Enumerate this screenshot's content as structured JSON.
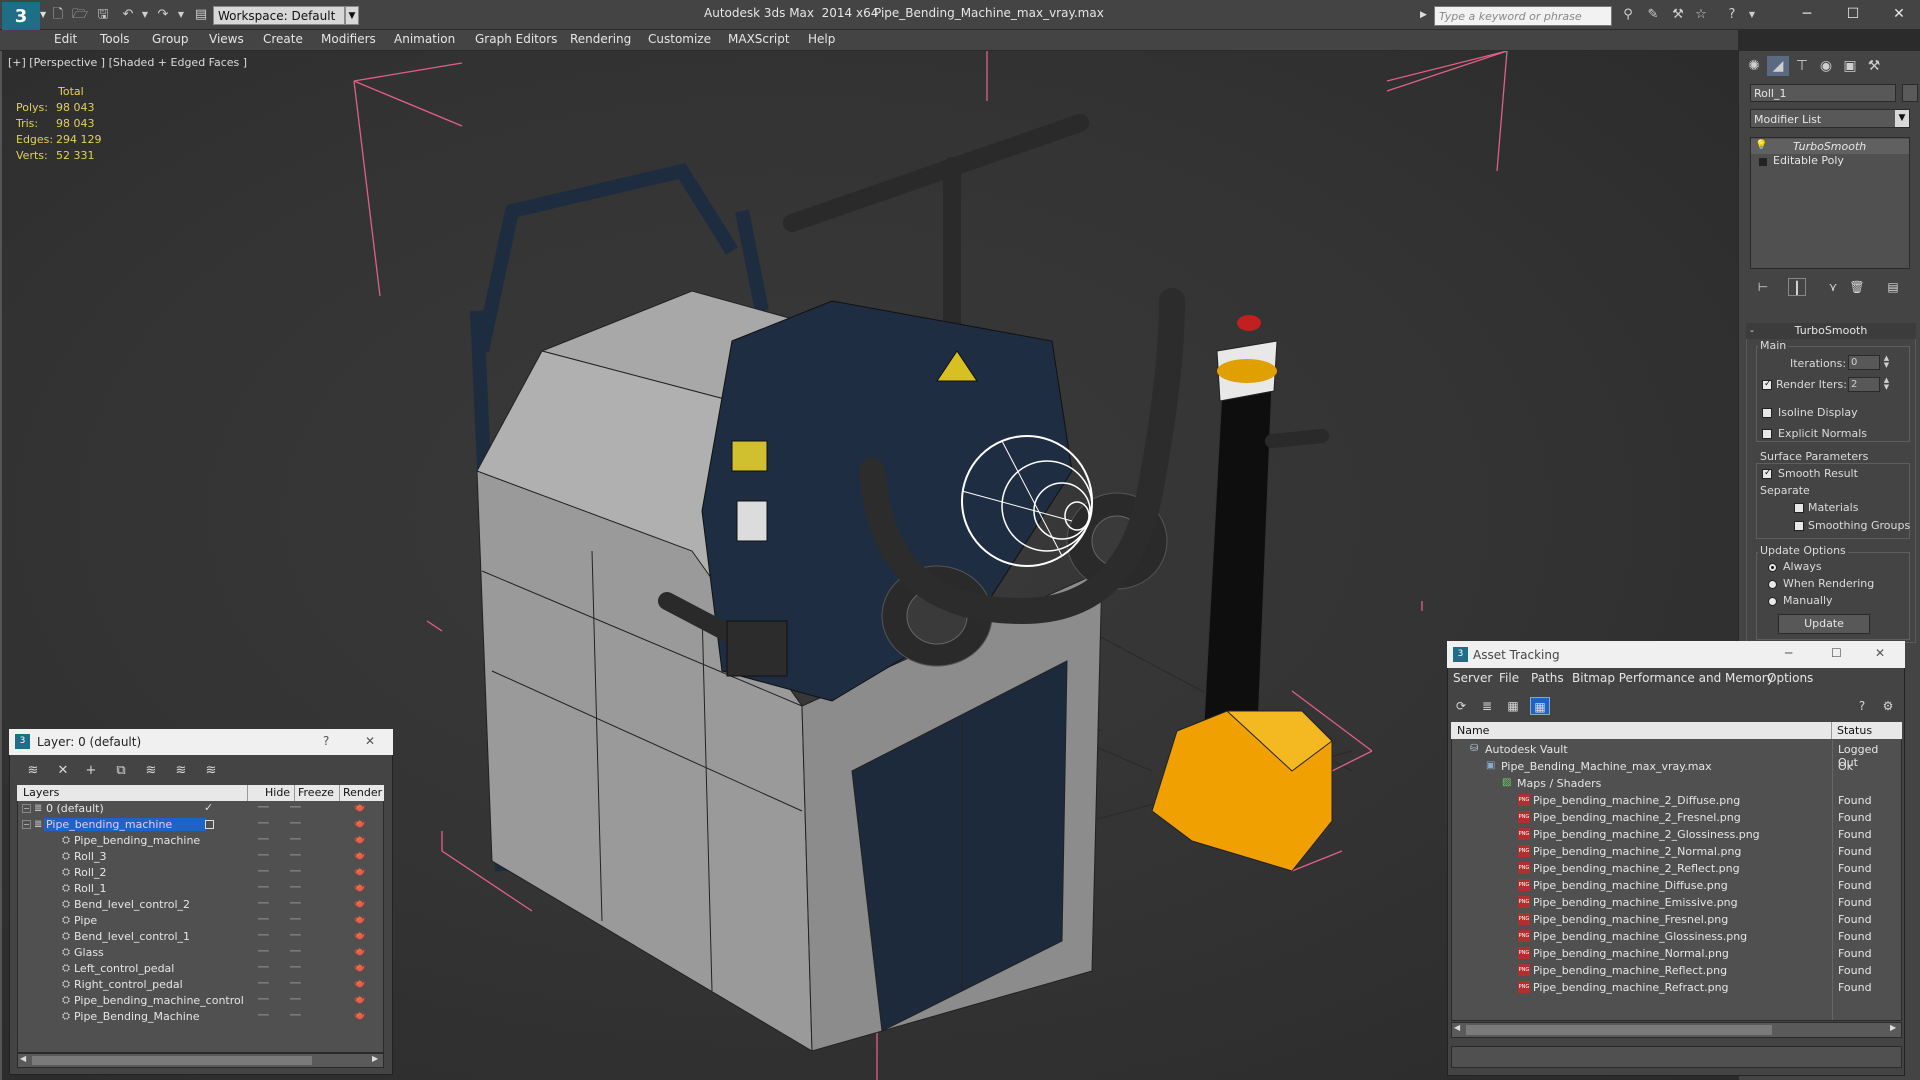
{
  "app": {
    "title": "Autodesk 3ds Max  2014 x64",
    "document": "Pipe_Bending_Machine_max_vray.max",
    "logo_text": "3",
    "workspace": "Workspace: Default",
    "search_placeholder": "Type a keyword or phrase"
  },
  "menu": [
    "Edit",
    "Tools",
    "Group",
    "Views",
    "Create",
    "Modifiers",
    "Animation",
    "Graph Editors",
    "Rendering",
    "Customize",
    "MAXScript",
    "Help"
  ],
  "viewport": {
    "label": "[+] [Perspective ] [Shaded + Edged Faces ]",
    "stats": {
      "header": "Total",
      "rows": [
        {
          "label": "Polys:",
          "value": "98 043"
        },
        {
          "label": "Tris:",
          "value": "98 043"
        },
        {
          "label": "Edges:",
          "value": "294 129"
        },
        {
          "label": "Verts:",
          "value": "52 331"
        }
      ]
    }
  },
  "command_panel": {
    "object_name": "Roll_1",
    "modifier_list": "Modifier List",
    "stack": [
      "TurboSmooth",
      "Editable Poly"
    ],
    "rollout_title": "TurboSmooth",
    "main_group": "Main",
    "iterations_label": "Iterations:",
    "iterations_value": "0",
    "render_iters_label": "Render Iters:",
    "render_iters_value": "2",
    "render_iters_checked": true,
    "isoline_label": "Isoline Display",
    "explicit_normals_label": "Explicit Normals",
    "surface_params_label": "Surface Parameters",
    "smooth_result_label": "Smooth Result",
    "separate_label": "Separate",
    "materials_label": "Materials",
    "smoothing_groups_label": "Smoothing Groups",
    "update_options_label": "Update Options",
    "update_always": "Always",
    "update_when_rendering": "When Rendering",
    "update_manually": "Manually",
    "update_button": "Update"
  },
  "layer_window": {
    "title": "Layer: 0 (default)",
    "help": "?",
    "columns": {
      "layers": "Layers",
      "hide": "Hide",
      "freeze": "Freeze",
      "render": "Render"
    },
    "rows": [
      {
        "name": "0 (default)",
        "level": 0,
        "type": "layer"
      },
      {
        "name": "Pipe_bending_machine",
        "level": 0,
        "type": "layer",
        "selected": true
      },
      {
        "name": "Pipe_bending_machine",
        "level": 1,
        "type": "object"
      },
      {
        "name": "Roll_3",
        "level": 1,
        "type": "object"
      },
      {
        "name": "Roll_2",
        "level": 1,
        "type": "object"
      },
      {
        "name": "Roll_1",
        "level": 1,
        "type": "object"
      },
      {
        "name": "Bend_level_control_2",
        "level": 1,
        "type": "object"
      },
      {
        "name": "Pipe",
        "level": 1,
        "type": "object"
      },
      {
        "name": "Bend_level_control_1",
        "level": 1,
        "type": "object"
      },
      {
        "name": "Glass",
        "level": 1,
        "type": "object"
      },
      {
        "name": "Left_control_pedal",
        "level": 1,
        "type": "object"
      },
      {
        "name": "Right_control_pedal",
        "level": 1,
        "type": "object"
      },
      {
        "name": "Pipe_bending_machine_control",
        "level": 1,
        "type": "object"
      },
      {
        "name": "Pipe_Bending_Machine",
        "level": 1,
        "type": "object"
      }
    ]
  },
  "asset_tracking": {
    "title": "Asset Tracking",
    "menu": [
      "Server",
      "File",
      "Paths",
      "Bitmap Performance and Memory",
      "Options"
    ],
    "columns": {
      "name": "Name",
      "status": "Status"
    },
    "rows": [
      {
        "name": "Autodesk Vault",
        "status": "Logged Out",
        "level": 0,
        "kind": "vault"
      },
      {
        "name": "Pipe_Bending_Machine_max_vray.max",
        "status": "Ok",
        "level": 1,
        "kind": "max"
      },
      {
        "name": "Maps / Shaders",
        "status": "",
        "level": 2,
        "kind": "folder"
      },
      {
        "name": "Pipe_bending_machine_2_Diffuse.png",
        "status": "Found",
        "level": 3,
        "kind": "png"
      },
      {
        "name": "Pipe_bending_machine_2_Fresnel.png",
        "status": "Found",
        "level": 3,
        "kind": "png"
      },
      {
        "name": "Pipe_bending_machine_2_Glossiness.png",
        "status": "Found",
        "level": 3,
        "kind": "png"
      },
      {
        "name": "Pipe_bending_machine_2_Normal.png",
        "status": "Found",
        "level": 3,
        "kind": "png"
      },
      {
        "name": "Pipe_bending_machine_2_Reflect.png",
        "status": "Found",
        "level": 3,
        "kind": "png"
      },
      {
        "name": "Pipe_bending_machine_Diffuse.png",
        "status": "Found",
        "level": 3,
        "kind": "png"
      },
      {
        "name": "Pipe_bending_machine_Emissive.png",
        "status": "Found",
        "level": 3,
        "kind": "png"
      },
      {
        "name": "Pipe_bending_machine_Fresnel.png",
        "status": "Found",
        "level": 3,
        "kind": "png"
      },
      {
        "name": "Pipe_bending_machine_Glossiness.png",
        "status": "Found",
        "level": 3,
        "kind": "png"
      },
      {
        "name": "Pipe_bending_machine_Normal.png",
        "status": "Found",
        "level": 3,
        "kind": "png"
      },
      {
        "name": "Pipe_bending_machine_Reflect.png",
        "status": "Found",
        "level": 3,
        "kind": "png"
      },
      {
        "name": "Pipe_bending_machine_Refract.png",
        "status": "Found",
        "level": 3,
        "kind": "png"
      }
    ]
  },
  "colors": {
    "ui_bg": "#444444",
    "viewport_bg": "#333333",
    "stats_text": "#e0d060",
    "selection": "#1e64c8",
    "bbox": "#e06088",
    "machine_blue": "#1c2a3c",
    "panel_grey": "#9a9a9a",
    "accent_orange": "#f0a000"
  }
}
